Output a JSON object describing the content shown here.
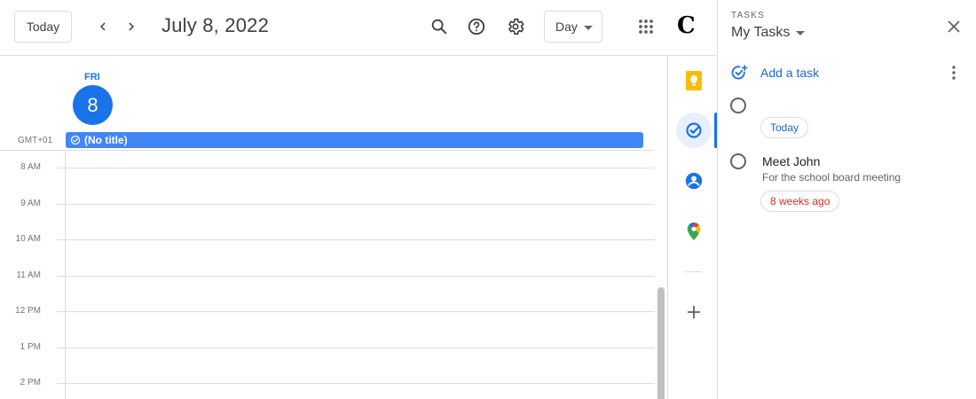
{
  "header": {
    "today_label": "Today",
    "date_title": "July 8, 2022",
    "view_selected": "Day",
    "brand_letter": "C"
  },
  "calendar": {
    "day_name": "FRI",
    "day_number": "8",
    "timezone": "GMT+01",
    "all_day_event": "(No title)",
    "hours": [
      "8 AM",
      "9 AM",
      "10 AM",
      "11 AM",
      "12 PM",
      "1 PM",
      "2 PM"
    ]
  },
  "tasks": {
    "kicker": "TASKS",
    "list_name": "My Tasks",
    "add_task_label": "Add a task",
    "items": [
      {
        "title": "",
        "notes": "",
        "due": "Today",
        "overdue": false
      },
      {
        "title": "Meet John",
        "notes": "For the school board meeting",
        "due": "8 weeks ago",
        "overdue": true
      }
    ]
  },
  "colors": {
    "accent": "#1a73e8",
    "event": "#4285f4",
    "overdue": "#d93025",
    "keep_yellow": "#fbbc04"
  },
  "icons": {
    "rail": [
      "keep-icon",
      "tasks-icon",
      "contacts-icon",
      "maps-icon",
      "add-icon"
    ]
  }
}
